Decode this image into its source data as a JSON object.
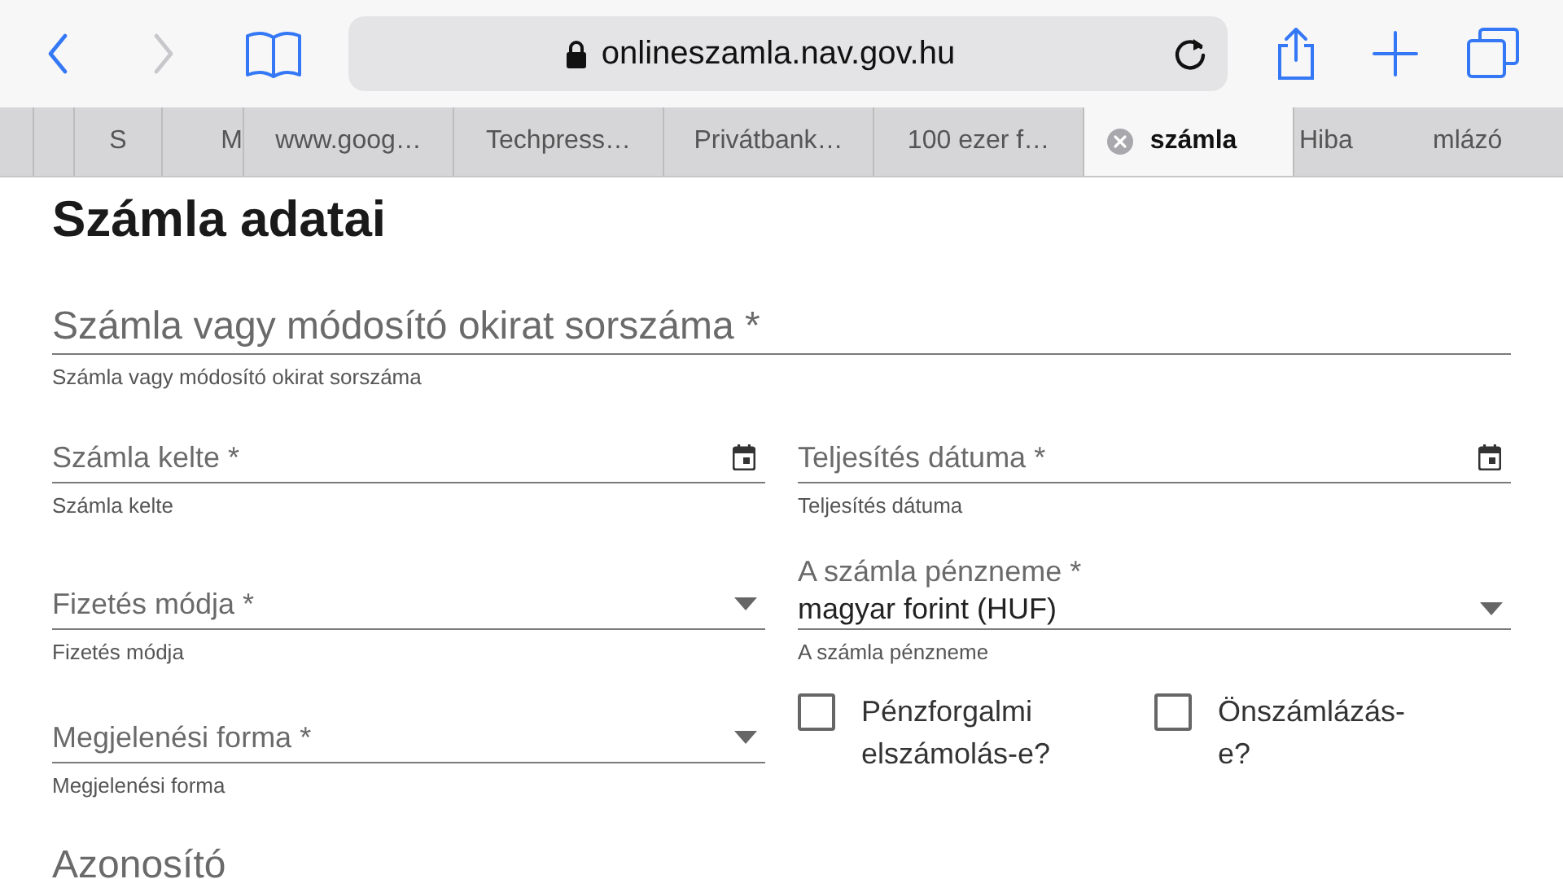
{
  "browser": {
    "url": "onlineszamla.nav.gov.hu",
    "secure": true,
    "back_disabled": false,
    "forward_disabled": true
  },
  "tabs": [
    {
      "label": "S",
      "kind": "stacked",
      "selected": false
    },
    {
      "label": "M",
      "kind": "stacked-end",
      "selected": false
    },
    {
      "label": "www.goog…",
      "kind": "normal",
      "selected": false
    },
    {
      "label": "Techpress…",
      "kind": "normal",
      "selected": false
    },
    {
      "label": "Privátbank…",
      "kind": "normal",
      "selected": false
    },
    {
      "label": "100 ezer f…",
      "kind": "normal",
      "selected": false
    },
    {
      "label": "számla",
      "kind": "normal",
      "selected": true
    },
    {
      "label": "Hiba",
      "kind": "short",
      "selected": false
    },
    {
      "label": "mlázó",
      "kind": "edge",
      "selected": false
    }
  ],
  "page": {
    "title": "Számla adatai",
    "rows": [
      [
        {
          "kind": "text",
          "label": "Számla vagy módosító okirat sorszáma *",
          "helper": "Számla vagy módosító okirat sorszáma"
        }
      ],
      [
        {
          "kind": "date",
          "label": "Számla kelte *",
          "helper": "Számla kelte"
        },
        {
          "kind": "date",
          "label": "Teljesítés dátuma *",
          "helper": "Teljesítés dátuma"
        }
      ],
      [
        {
          "kind": "select",
          "label": "Fizetés módja *",
          "helper": "Fizetés módja"
        },
        {
          "kind": "select",
          "label": "A számla pénzneme *",
          "value": "magyar forint (HUF)",
          "helper": "A számla pénzneme"
        }
      ],
      [
        {
          "kind": "select",
          "label": "Megjelenési forma *",
          "helper": "Megjelenési forma"
        },
        {
          "kind": "checkboxes",
          "items": [
            {
              "label": "Pénzforgalmi elszámolás-e?",
              "checked": false
            },
            {
              "label": "Önszámlázás-e?",
              "checked": false
            }
          ]
        }
      ]
    ],
    "section": "Azonosító"
  }
}
